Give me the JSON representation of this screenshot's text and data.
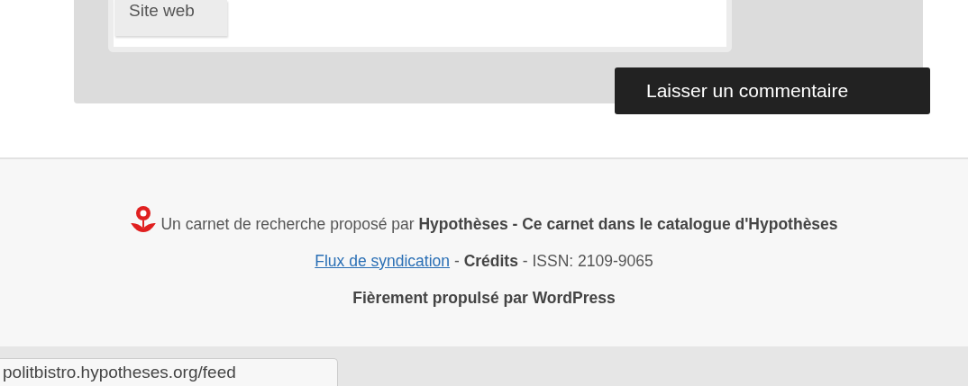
{
  "comment_form": {
    "website_label": "Site web",
    "submit_button": "Laisser un commentaire"
  },
  "footer": {
    "line_1": "Un carnet de recherche proposé par **Hypothèses - Ce carnet dans le catalogue d'Hypothèses**",
    "feed_link": "Flux de syndication",
    "line_2": " - **Crédits** - ISSN: 2109-9065",
    "line_3": "Fièrement propulsé par WordPress"
  },
  "status_bar": {
    "url": "politbistro.hypotheses.org/feed"
  }
}
